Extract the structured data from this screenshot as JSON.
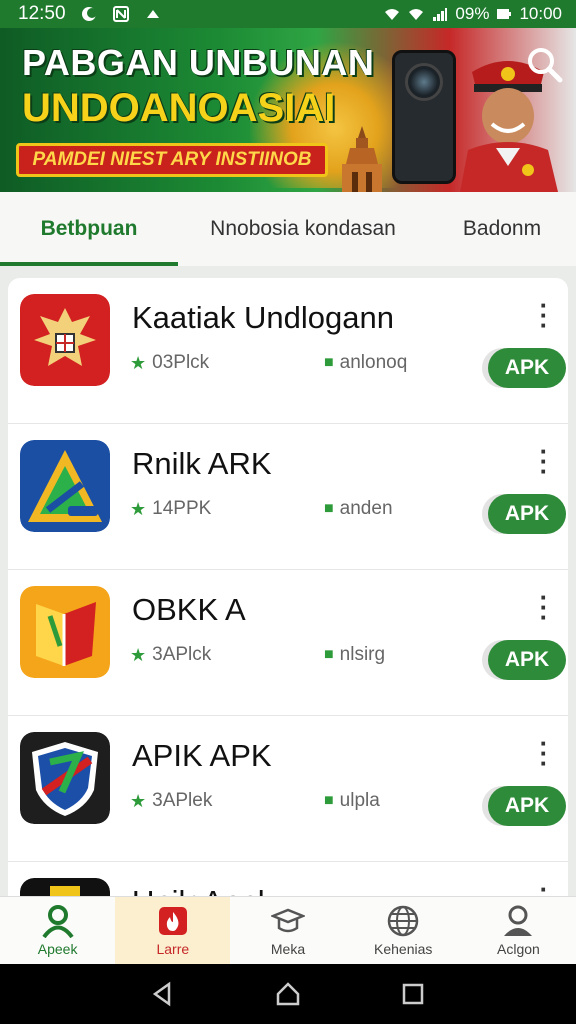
{
  "status_bar": {
    "time": "12:50",
    "battery_text": "09%",
    "clock_right": "10:00"
  },
  "banner": {
    "title_line1": "PABGAN UNBUNAN",
    "title_line2": "UNDOANOASIAI",
    "ribbon": "PAMDEI NIEST ARY INSTIINOB"
  },
  "tabs": [
    {
      "label": "Betbpuan",
      "active": true
    },
    {
      "label": "Nnobosia kondasan",
      "active": false
    },
    {
      "label": "Badonm",
      "active": false
    }
  ],
  "apps": [
    {
      "name": "Kaatiak Undlogann",
      "rating": "03Plck",
      "category": "anlonoq",
      "button": "APK",
      "icon": "garuda-icon"
    },
    {
      "name": "Rnilk ARK",
      "rating": "14PPK",
      "category": "anden",
      "button": "APK",
      "icon": "triangle-logo-icon"
    },
    {
      "name": "OBKK A",
      "rating": "3APlck",
      "category": "nlsirg",
      "button": "APK",
      "icon": "book-logo-icon"
    },
    {
      "name": "APIK APK",
      "rating": "3APlek",
      "category": "ulpla",
      "button": "APK",
      "icon": "shield-logo-icon"
    },
    {
      "name": "Unilr Apnk",
      "rating": "",
      "category": "",
      "button": "",
      "icon": "partial-app-icon"
    }
  ],
  "bottom_nav": [
    {
      "label": "Apeek",
      "icon": "person-icon",
      "state": "active"
    },
    {
      "label": "Larre",
      "icon": "fire-icon",
      "state": "highlight"
    },
    {
      "label": "Meka",
      "icon": "mortarboard-icon",
      "state": ""
    },
    {
      "label": "Kehenias",
      "icon": "globe-icon",
      "state": ""
    },
    {
      "label": "Aclgon",
      "icon": "account-icon",
      "state": ""
    }
  ],
  "colors": {
    "primary_green": "#1f7a2e",
    "apk_button": "#2e8b3a",
    "banner_red": "#c9211b",
    "banner_yellow": "#f7d21b"
  }
}
